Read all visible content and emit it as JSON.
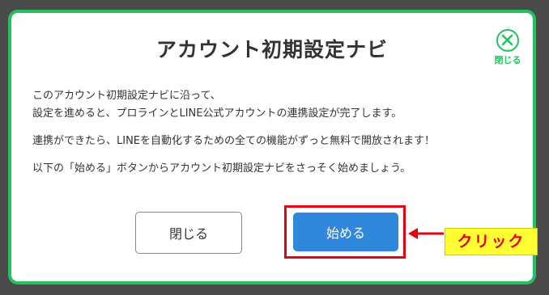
{
  "modal": {
    "title": "アカウント初期設定ナビ",
    "close_label": "閉じる",
    "paragraphs": [
      "このアカウント初期設定ナビに沿って、",
      "設定を進めると、プロラインとLINE公式アカウントの連携設定が完了します。",
      "連携ができたら、LINEを自動化するための全ての機能がずっと無料で開放されます！",
      "以下の「始める」ボタンからアカウント初期設定ナビをさっそく始めましょう。"
    ],
    "buttons": {
      "close_label": "閉じる",
      "start_label": "始める"
    }
  },
  "annotation": {
    "callout_label": "クリック"
  },
  "colors": {
    "accent_green": "#22c35e",
    "primary_blue": "#2f88db",
    "highlight_red": "#e60012",
    "callout_yellow": "#ffff33",
    "backdrop": "#4a4a4a"
  },
  "icons": {
    "close": "close-circle-icon",
    "arrow": "arrow-left-icon"
  }
}
